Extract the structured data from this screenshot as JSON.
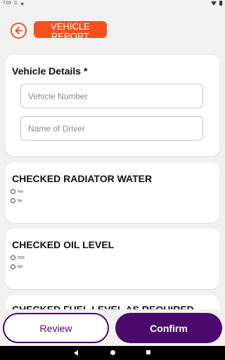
{
  "status_bar": {
    "time": "7:03",
    "left_icons": [
      "G",
      "◉"
    ]
  },
  "header": {
    "title": "VEHICLE REPORT",
    "back_icon": "back-arrow-circle-icon",
    "accent_color": "#f4511e"
  },
  "vehicle_details": {
    "heading": "Vehicle Details  *",
    "vehicle_number_placeholder": "Vehicle Number",
    "driver_placeholder": "Name of Driver"
  },
  "checks": [
    {
      "heading": "CHECKED RADIATOR WATER",
      "options": [
        "Yes",
        "No"
      ]
    },
    {
      "heading": "CHECKED OIL LEVEL",
      "options": [
        "YES",
        "NO"
      ]
    },
    {
      "heading": "CHECKED FUEL LEVEL AS REQUIRED"
    }
  ],
  "footer": {
    "review_label": "Review",
    "confirm_label": "Confirm",
    "primary_color": "#4a0a6b"
  }
}
